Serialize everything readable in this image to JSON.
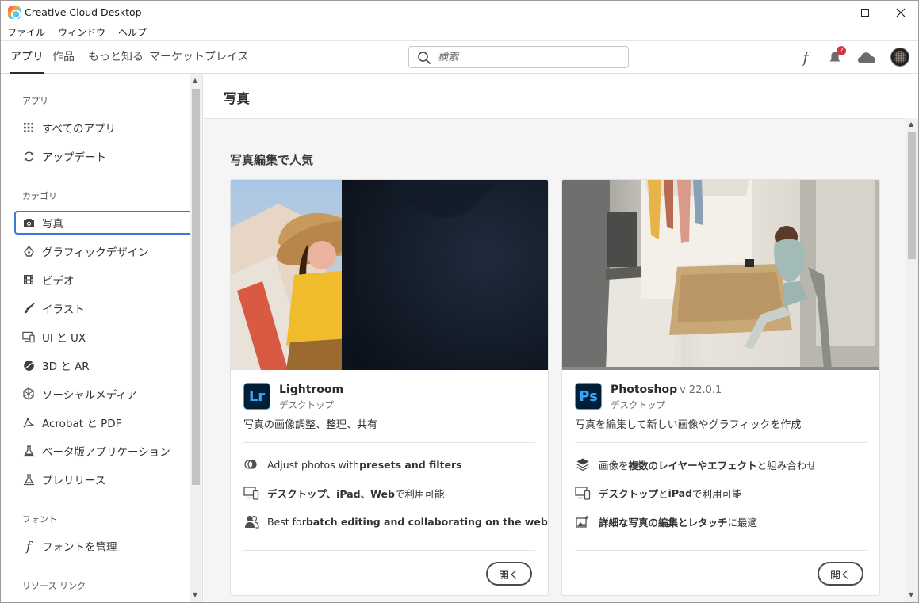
{
  "window": {
    "title": "Creative Cloud Desktop"
  },
  "menu": [
    "ファイル",
    "ウィンドウ",
    "ヘルプ"
  ],
  "tabs": [
    "アプリ",
    "作品",
    "もっと知る",
    "マーケットプレイス"
  ],
  "search": {
    "placeholder": "検索"
  },
  "notifications": {
    "count": "2"
  },
  "sidebar": {
    "section_apps": "アプリ",
    "all_apps": "すべてのアプリ",
    "updates": "アップデート",
    "section_categories": "カテゴリ",
    "categories": [
      "写真",
      "グラフィックデザイン",
      "ビデオ",
      "イラスト",
      "UI と UX",
      "3D と AR",
      "ソーシャルメディア",
      "Acrobat と PDF",
      "ベータ版アプリケーション",
      "プレリリース"
    ],
    "section_fonts": "フォント",
    "manage_fonts": "フォントを管理",
    "section_resources": "リソース リンク"
  },
  "main": {
    "title": "写真",
    "section_title": "写真編集で人気",
    "cards": [
      {
        "name": "Lightroom",
        "version": "",
        "badge": "Lr",
        "platform": "デスクトップ",
        "description": "写真の画像調整、整理、共有",
        "feature1_plain": "Adjust photos with ",
        "feature1_bold": "presets and filters",
        "feature2_bold": "デスクトップ、iPad、Web",
        "feature2_plain": " で利用可能",
        "feature3_plain": "Best for ",
        "feature3_bold": "batch editing and collaborating on the web",
        "open_label": "開く"
      },
      {
        "name": "Photoshop",
        "version": "v 22.0.1",
        "badge": "Ps",
        "platform": "デスクトップ",
        "description": "写真を編集して新しい画像やグラフィックを作成",
        "feature1_plain": "画像を",
        "feature1_bold": "複数のレイヤーやエフェクト",
        "feature1_tail": "と組み合わせ",
        "feature2_bold": "デスクトップ",
        "feature2_mid": "と ",
        "feature2_bold2": "iPad",
        "feature2_plain": " で利用可能",
        "feature3_bold": "詳細な写真の編集とレタッチ",
        "feature3_plain": "に最適",
        "open_label": "開く"
      }
    ]
  },
  "colors": {
    "accent_focus": "#3b78d8",
    "badge_red": "#d7373f",
    "app_badge_bg": "#001e36",
    "app_badge_fg": "#31a8ff"
  }
}
